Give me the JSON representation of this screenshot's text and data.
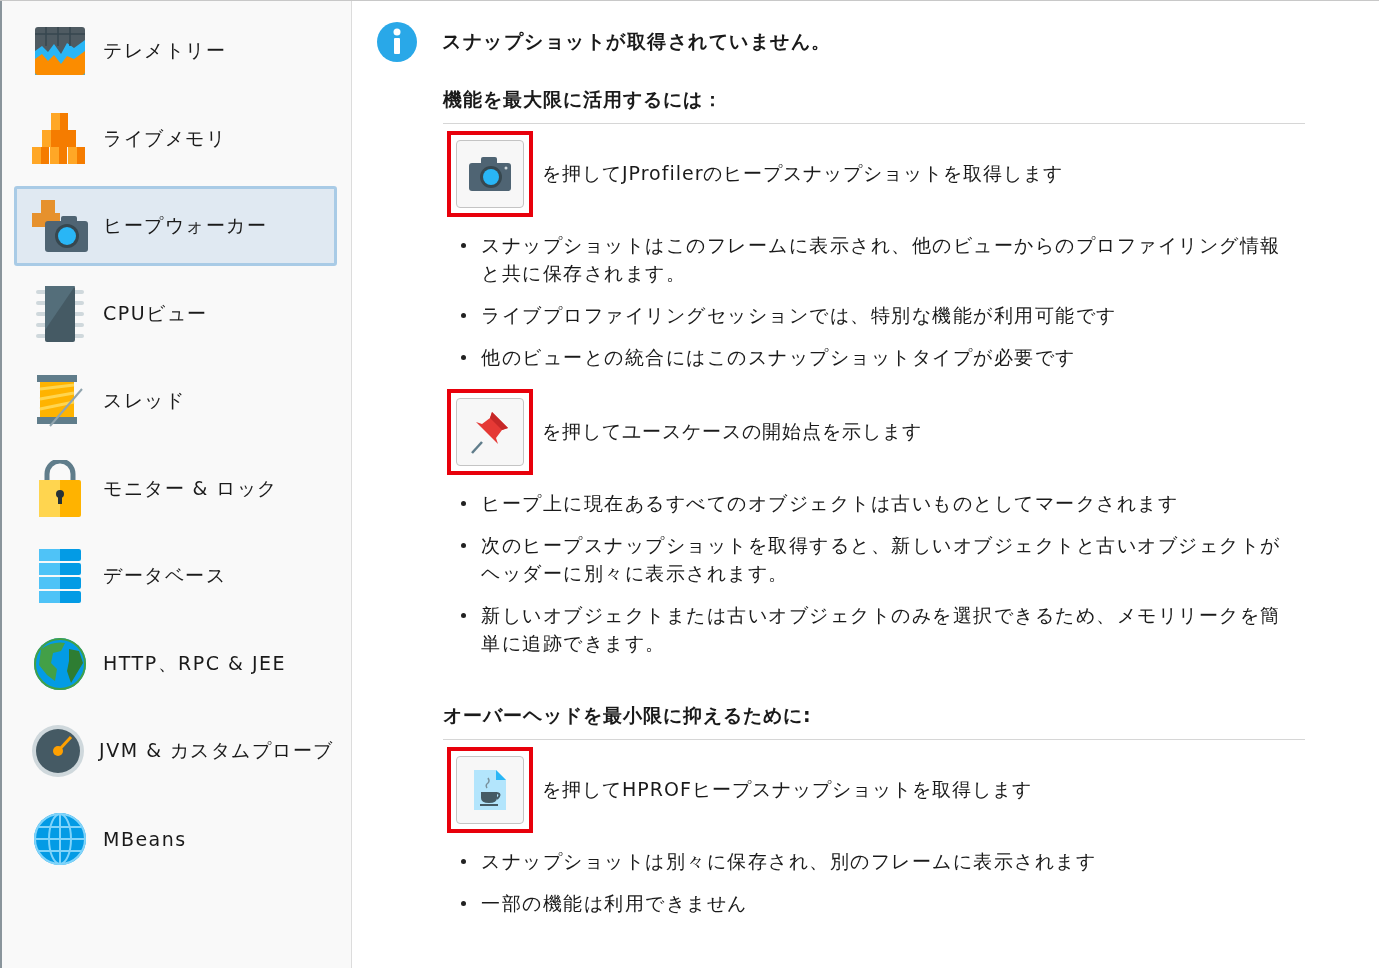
{
  "sidebar": {
    "items": [
      {
        "label": "テレメトリー",
        "kind": "chart",
        "selected": false
      },
      {
        "label": "ライブメモリ",
        "kind": "blocks",
        "selected": false
      },
      {
        "label": "ヒープウォーカー",
        "kind": "heap",
        "selected": true
      },
      {
        "label": "CPUビュー",
        "kind": "chip",
        "selected": false
      },
      {
        "label": "スレッド",
        "kind": "spool",
        "selected": false
      },
      {
        "label": "モニター & ロック",
        "kind": "lock",
        "selected": false
      },
      {
        "label": "データベース",
        "kind": "database",
        "selected": false
      },
      {
        "label": "HTTP、RPC & JEE",
        "kind": "earth",
        "selected": false
      },
      {
        "label": "JVM & カスタムプローブ",
        "kind": "gauge",
        "selected": false
      },
      {
        "label": "MBeans",
        "kind": "globe",
        "selected": false
      }
    ]
  },
  "notice": {
    "title": "スナップショットが取得されていません。"
  },
  "sections": [
    {
      "heading": "機能を最大限に活用するには：",
      "actions": [
        {
          "kind": "camera",
          "text": "を押してJProfilerのヒープスナップショットを取得します",
          "bullets": [
            "スナップショットはこのフレームに表示され、他のビューからのプロファイリング情報と共に保存されます。",
            "ライブプロファイリングセッションでは、特別な機能が利用可能です",
            "他のビューとの統合にはこのスナップショットタイプが必要です"
          ]
        },
        {
          "kind": "pin",
          "text": "を押してユースケースの開始点を示します",
          "bullets": [
            "ヒープ上に現在あるすべてのオブジェクトは古いものとしてマークされます",
            "次のヒープスナップショットを取得すると、新しいオブジェクトと古いオブジェクトがヘッダーに別々に表示されます。",
            "新しいオブジェクトまたは古いオブジェクトのみを選択できるため、メモリリークを簡単に追跡できます。"
          ]
        }
      ]
    },
    {
      "heading": "オーバーヘッドを最小限に抑えるために:",
      "actions": [
        {
          "kind": "hprof",
          "text": "を押してHPROFヒープスナップショットを取得します",
          "bullets": [
            "スナップショットは別々に保存され、別のフレームに表示されます",
            "一部の機能は利用できません"
          ]
        }
      ]
    }
  ]
}
